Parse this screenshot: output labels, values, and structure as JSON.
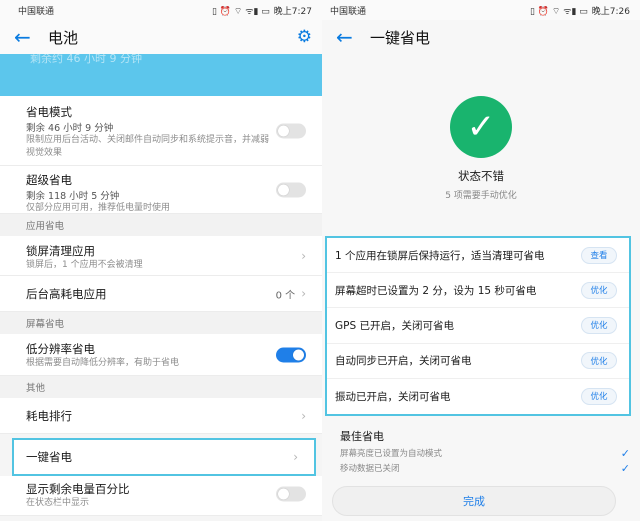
{
  "left": {
    "status": {
      "carrier": "中国联通",
      "icons": "▯ ⏰ ⌔ ᯤ▮ ▭",
      "time": "晚上7:27"
    },
    "header": {
      "back_icon": "back-arrow-icon",
      "title": "电池",
      "settings_icon": "gear-icon"
    },
    "hero_faded_text": "剩余约 46 小时 9 分钟",
    "power_mode": {
      "title": "省电模式",
      "remaining": "剩余 46 小时 9 分钟",
      "desc": "限制应用后台活动、关闭邮件自动同步和系统提示音，并减弱视觉效果",
      "enabled": false
    },
    "ultra_mode": {
      "title": "超级省电",
      "remaining": "剩余 118 小时 5 分钟",
      "desc": "仅部分应用可用，推荐低电量时使用",
      "enabled": false
    },
    "section_app": "应用省电",
    "lock_clean": {
      "title": "锁屏清理应用",
      "desc": "锁屏后，1 个应用不会被清理"
    },
    "background_high": {
      "title": "后台高耗电应用",
      "value": "0 个"
    },
    "section_screen": "屏幕省电",
    "low_res": {
      "title": "低分辨率省电",
      "desc": "根据需要自动降低分辨率，有助于省电",
      "enabled": true
    },
    "section_other": "其他",
    "ranking": {
      "title": "耗电排行"
    },
    "one_key": {
      "title": "一键省电"
    },
    "show_percent": {
      "title": "显示剩余电量百分比",
      "desc": "在状态栏中显示",
      "enabled": false
    }
  },
  "right": {
    "status": {
      "carrier": "中国联通",
      "icons": "▯ ⏰ ⌔ ᯤ▮ ▭",
      "time": "晚上7:26"
    },
    "header": {
      "back_icon": "back-arrow-icon",
      "title": "一键省电"
    },
    "check_icon": "check-circle-icon",
    "status_title": "状态不错",
    "status_sub": "5 项需要手动优化",
    "items": [
      {
        "text": "1 个应用在锁屏后保持运行，适当清理可省电",
        "button": "查看"
      },
      {
        "text": "屏幕超时已设置为 2 分，设为 15 秒可省电",
        "button": "优化"
      },
      {
        "text": "GPS 已开启，关闭可省电",
        "button": "优化"
      },
      {
        "text": "自动同步已开启，关闭可省电",
        "button": "优化"
      },
      {
        "text": "振动已开启，关闭可省电",
        "button": "优化"
      }
    ],
    "best": {
      "title": "最佳省电",
      "items": [
        {
          "text": "屏幕亮度已设置为自动模式"
        },
        {
          "text": "移动数据已关闭"
        }
      ]
    },
    "done_label": "完成"
  }
}
